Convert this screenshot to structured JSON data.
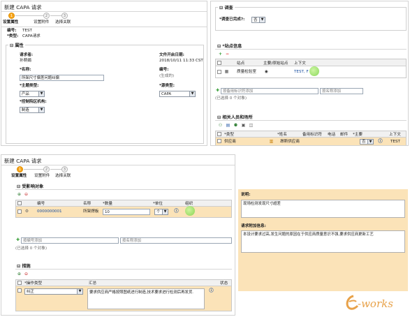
{
  "windows": {
    "top_left": {
      "title": "新建 CAPA 请求",
      "steps": [
        "设置属性",
        "设置附件",
        "选择关联"
      ],
      "step_numbers": [
        "1",
        "2",
        "3"
      ],
      "header": {
        "code_label": "编号:",
        "code_value": "TEST",
        "type_label": "*类型:",
        "type_value": "CAPA请求"
      },
      "attributes": {
        "section": "属性",
        "requester_label": "请求者:",
        "requester_value": "孙萌娟",
        "submit_date_label": "文件开启日期:",
        "submit_date_value": "2018/10/11 11:33 CST",
        "name_label": "*名称:",
        "name_value": "所架尺寸偏差问题纠偏",
        "number_label": "编号:",
        "number_value": "(生成的)",
        "subject_type_label": "*主题类型:",
        "subject_type_value": "产品",
        "source_type_label": "*源类型:",
        "source_type_value": "CAPA",
        "control_org_label": "*控制院区机构:",
        "control_org_value": "制造"
      }
    },
    "top_right": {
      "survey_section": "调查",
      "survey_complete_label": "*调查已完成?:",
      "survey_complete_value": "否",
      "site_section": "*站点信息",
      "site_columns": [
        "站点",
        "主要/原始站点",
        "上下文"
      ],
      "site_row": {
        "site": "质量检验室",
        "primary": "◉",
        "context": "TEST, F"
      },
      "add_by_number_placeholder": "按备用标识符添加",
      "add_by_name_placeholder": "按名称添加",
      "selected_count": "(已选择 0 个对象)",
      "people_section": "相关人员和场所",
      "people_columns": [
        "*类型",
        "*姓名",
        "备用标识符",
        "电话",
        "邮件",
        "*主要",
        "上下文"
      ],
      "people_row": {
        "type": "供应商",
        "name": "昂斯供应商",
        "primary": "否",
        "context": "TEST"
      }
    },
    "bottom_left": {
      "title": "新建 CAPA 请求",
      "steps": [
        "设置属性",
        "设置附件",
        "选择关联"
      ],
      "step_numbers": [
        "1",
        "2",
        "3"
      ],
      "affected_section": "受影响对象",
      "affected_columns": [
        "编号",
        "名称",
        "*数量",
        "*单位",
        "组织"
      ],
      "affected_row": {
        "number": "0000000001",
        "name": "所架焊板",
        "quantity": "10",
        "unit": "个"
      },
      "add_by_number_placeholder": "按编号添加",
      "add_by_name_placeholder": "按名称添加",
      "selected_count": "(已选择 0 个对象)",
      "measures_section": "措施",
      "measures_columns": [
        "*操作类型",
        "汇总",
        "状态"
      ],
      "measures_row": {
        "type": "纠正",
        "summary": "要求供应商严格按照图纸进行制造,技术要求进行检测后再发货."
      }
    },
    "bottom_right": {
      "description_label": "说明:",
      "description_value": "现场检测发现尺寸超差",
      "extra_label": "请求附加信息:",
      "extra_value": "本设计要求过高,发生问题的原因在于供应商质量意识不强,要求供应商更新工艺"
    }
  },
  "watermark": {
    "text": "e-works"
  },
  "colors": {
    "highlight_row": "#fbe3b8",
    "active_step": "#f7a51a",
    "brand_orange": "#e8a24a",
    "link_blue": "#1a4fa0"
  }
}
